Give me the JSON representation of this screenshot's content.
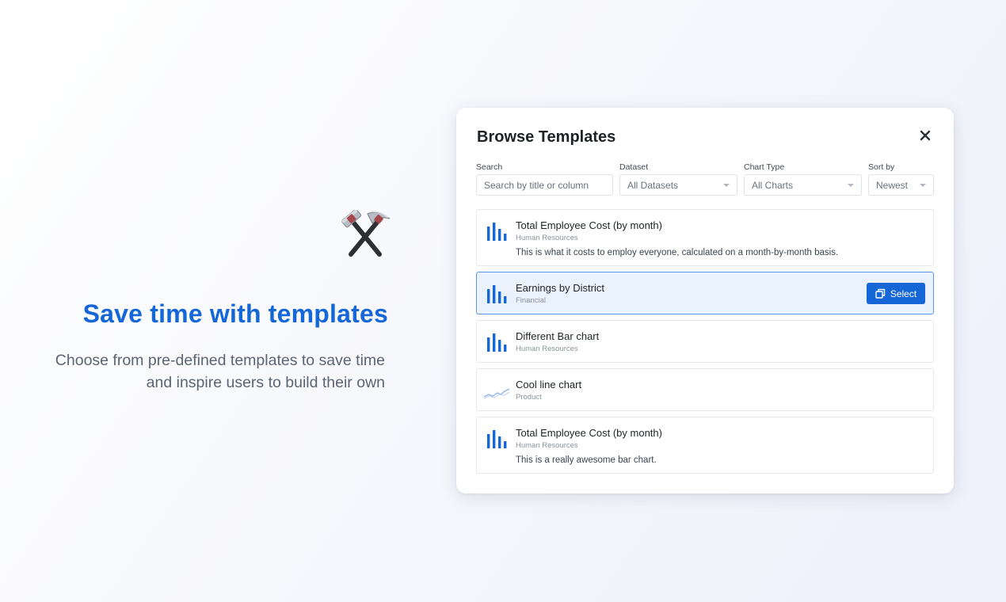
{
  "promo": {
    "icon": "hammer-and-pick-icon",
    "title": "Save time with templates",
    "subtitle": "Choose from pre-defined templates to save time and inspire users to build their own"
  },
  "modal": {
    "title": "Browse Templates",
    "close_icon": "close-icon",
    "filters": {
      "search": {
        "label": "Search",
        "placeholder": "Search by title or column",
        "value": ""
      },
      "dataset": {
        "label": "Dataset",
        "value": "All Datasets"
      },
      "chart_type": {
        "label": "Chart Type",
        "value": "All Charts"
      },
      "sort_by": {
        "label": "Sort by",
        "value": "Newest"
      }
    },
    "select_label": "Select",
    "templates": [
      {
        "title": "Total Employee Cost (by month)",
        "dataset": "Human Resources",
        "description": "This is what it costs to employ everyone, calculated on a month-by-month basis.",
        "icon": "bar-chart-icon",
        "selected": false
      },
      {
        "title": "Earnings by District",
        "dataset": "Financial",
        "description": "",
        "icon": "bar-chart-icon",
        "selected": true
      },
      {
        "title": "Different Bar chart",
        "dataset": "Human Resources",
        "description": "",
        "icon": "bar-chart-icon",
        "selected": false
      },
      {
        "title": "Cool line chart",
        "dataset": "Product",
        "description": "",
        "icon": "line-chart-icon",
        "selected": false
      },
      {
        "title": "Total Employee Cost (by month)",
        "dataset": "Human Resources",
        "description": "This is a really awesome bar chart.",
        "icon": "bar-chart-icon",
        "selected": false
      }
    ]
  },
  "colors": {
    "accent": "#1566d6",
    "selected_bg": "#eaf2fe",
    "selected_border": "#5c97ea"
  }
}
